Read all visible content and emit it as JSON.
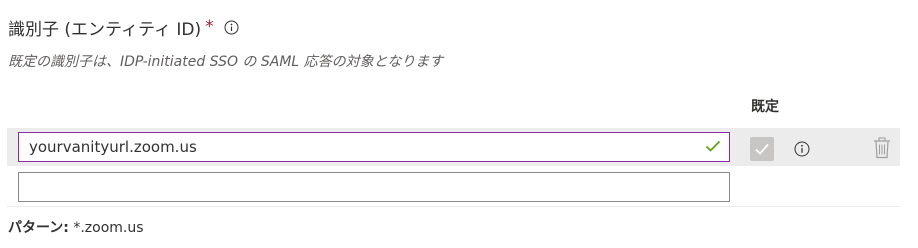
{
  "field": {
    "title": "識別子 (エンティティ ID)",
    "required_mark": "*",
    "description": "既定の識別子は、IDP-initiated SSO の SAML 応答の対象となります"
  },
  "table": {
    "default_column_header": "既定",
    "rows": [
      {
        "value": "yourvanityurl.zoom.us",
        "valid": true,
        "is_default": true
      },
      {
        "value": "",
        "placeholder": ""
      }
    ]
  },
  "pattern": {
    "label": "パターン:",
    "value": "*.zoom.us"
  },
  "icons": {
    "info": "info-icon",
    "check": "checkmark-icon",
    "delete": "trash-icon"
  },
  "colors": {
    "required": "#a4262c",
    "active_border": "#8a2da5",
    "valid_check": "#57a300",
    "row_highlight": "#ececec"
  }
}
